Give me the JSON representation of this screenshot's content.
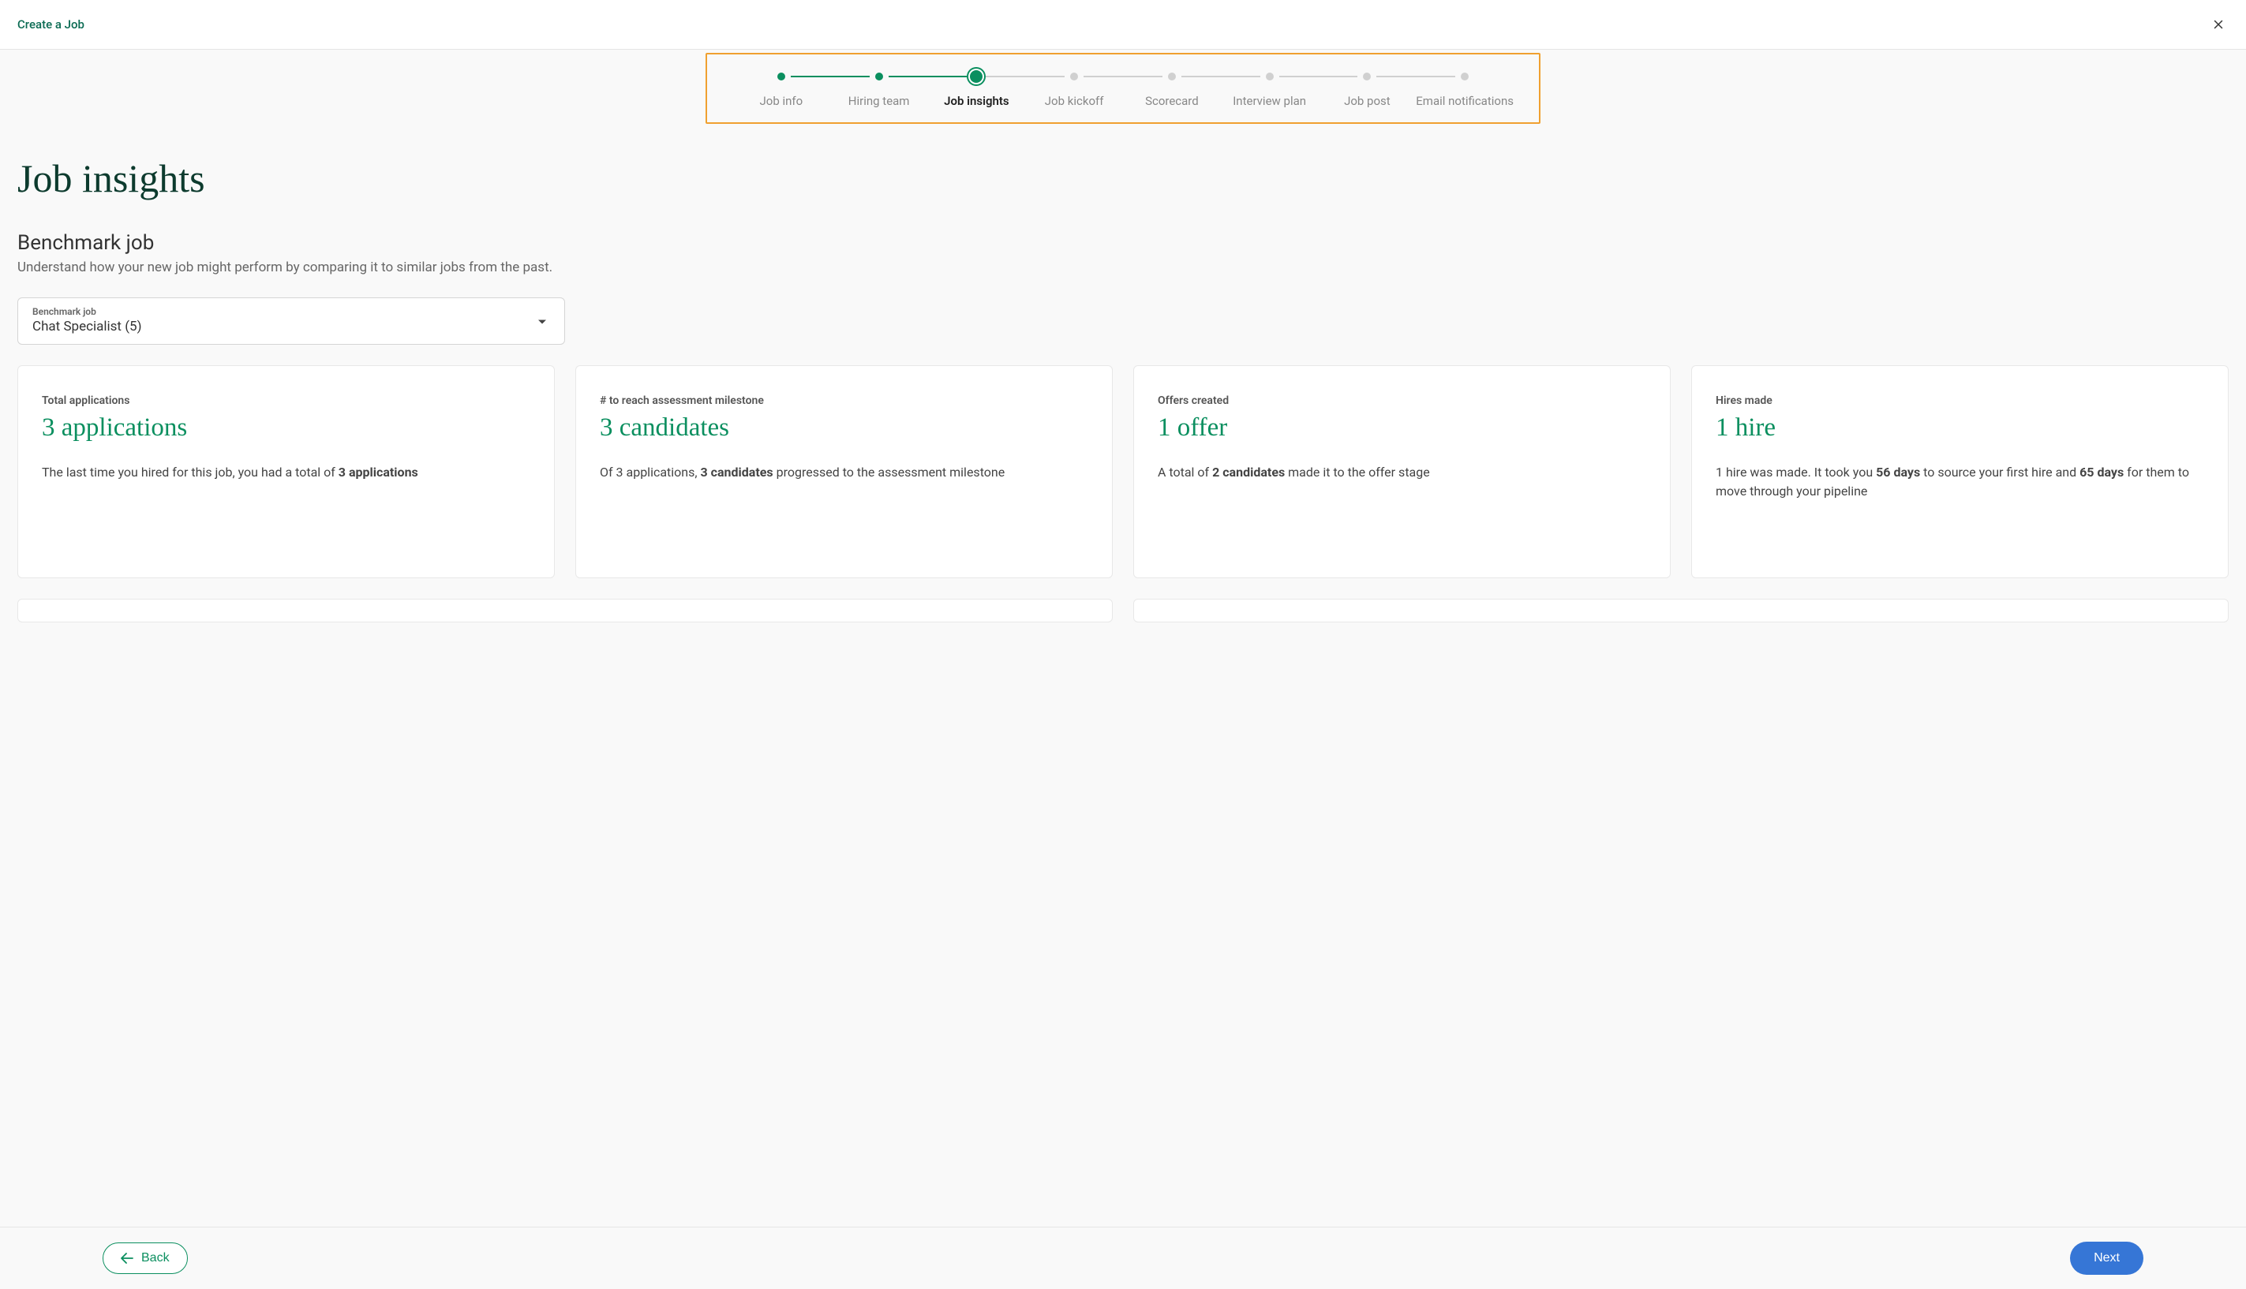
{
  "header": {
    "title": "Create a Job"
  },
  "stepper": {
    "steps": [
      {
        "label": "Job info",
        "state": "done"
      },
      {
        "label": "Hiring team",
        "state": "done"
      },
      {
        "label": "Job insights",
        "state": "current"
      },
      {
        "label": "Job kickoff",
        "state": "future"
      },
      {
        "label": "Scorecard",
        "state": "future"
      },
      {
        "label": "Interview plan",
        "state": "future"
      },
      {
        "label": "Job post",
        "state": "future"
      },
      {
        "label": "Email notifications",
        "state": "future"
      }
    ]
  },
  "page": {
    "title": "Job insights",
    "section_title": "Benchmark job",
    "section_subtitle": "Understand how your new job might perform by comparing it to similar jobs from the past."
  },
  "select": {
    "label": "Benchmark job",
    "value": "Chat Specialist (5)"
  },
  "cards": [
    {
      "label": "Total applications",
      "value": "3 applications",
      "desc_pre": "The last time you hired for this job, you had a total of ",
      "desc_bold1": "3 applications",
      "desc_mid": "",
      "desc_bold2": "",
      "desc_post": ""
    },
    {
      "label": "# to reach assessment milestone",
      "value": "3 candidates",
      "desc_pre": "Of 3 applications, ",
      "desc_bold1": "3 candidates",
      "desc_mid": " progressed to the assessment milestone",
      "desc_bold2": "",
      "desc_post": ""
    },
    {
      "label": "Offers created",
      "value": "1 offer",
      "desc_pre": "A total of ",
      "desc_bold1": "2 candidates",
      "desc_mid": " made it to the offer stage",
      "desc_bold2": "",
      "desc_post": ""
    },
    {
      "label": "Hires made",
      "value": "1 hire",
      "desc_pre": "1 hire was made. It took you ",
      "desc_bold1": "56 days",
      "desc_mid": " to source your first hire and ",
      "desc_bold2": "65 days",
      "desc_post": " for them to move through your pipeline"
    }
  ],
  "footer": {
    "back": "Back",
    "next": "Next"
  }
}
